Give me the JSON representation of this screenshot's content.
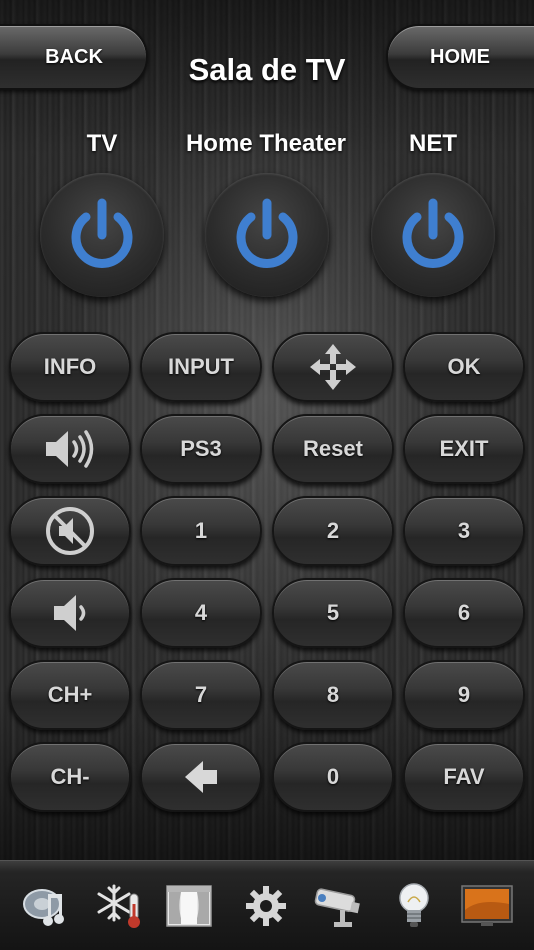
{
  "header": {
    "back_label": "BACK",
    "home_label": "HOME",
    "title": "Sala de TV"
  },
  "devices": [
    {
      "label": "TV",
      "icon": "power-icon"
    },
    {
      "label": "Home Theater",
      "icon": "power-icon"
    },
    {
      "label": "NET",
      "icon": "power-icon"
    }
  ],
  "keypad": {
    "rows": [
      [
        "INFO",
        "INPUT",
        "move-icon",
        "OK"
      ],
      [
        "volume-up-icon",
        "PS3",
        "Reset",
        "EXIT"
      ],
      [
        "mute-icon",
        "1",
        "2",
        "3"
      ],
      [
        "volume-down-icon",
        "4",
        "5",
        "6"
      ],
      [
        "CH+",
        "7",
        "8",
        "9"
      ],
      [
        "CH-",
        "back-arrow-icon",
        "0",
        "FAV"
      ]
    ]
  },
  "bottom_tabs": [
    {
      "icon": "audio-video-icon"
    },
    {
      "icon": "climate-icon"
    },
    {
      "icon": "curtains-icon"
    },
    {
      "icon": "settings-gear-icon"
    },
    {
      "icon": "security-camera-icon"
    },
    {
      "icon": "lighting-bulb-icon"
    },
    {
      "icon": "tv-screen-icon",
      "active": true
    }
  ],
  "colors": {
    "power_accent": "#3f7fd0",
    "button_text": "#d8d8d8",
    "title_text": "#ffffff"
  }
}
